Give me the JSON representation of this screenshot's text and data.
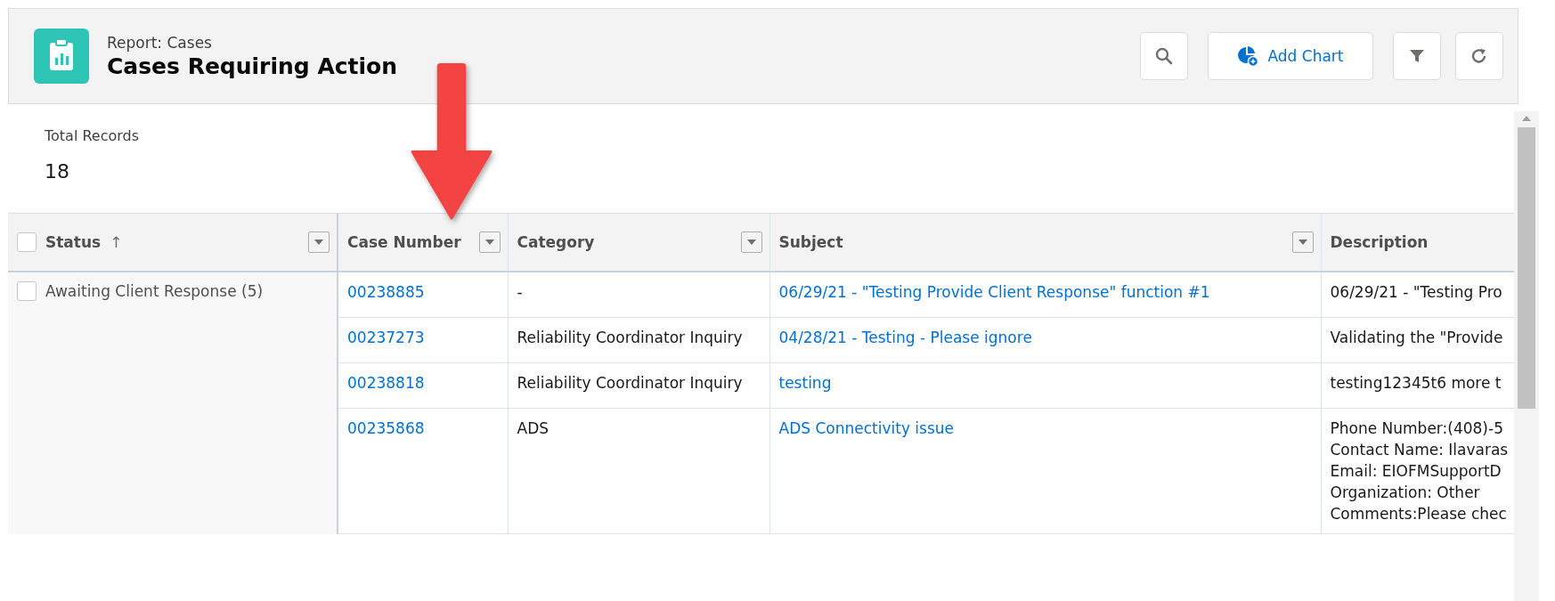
{
  "header": {
    "subtitle": "Report: Cases",
    "title": "Cases Requiring Action",
    "buttons": [
      {
        "kind": "search"
      },
      {
        "kind": "add-chart",
        "label": "Add Chart"
      },
      {
        "kind": "filter"
      },
      {
        "kind": "refresh"
      }
    ]
  },
  "summary": {
    "label": "Total Records",
    "value": "18"
  },
  "table": {
    "columns": [
      {
        "label": "Status",
        "sort_mark": "↑",
        "menu": true,
        "checked": false
      },
      {
        "label": "Case Number",
        "menu": true
      },
      {
        "label": "Category",
        "menu": true
      },
      {
        "label": "Subject",
        "menu": true
      },
      {
        "label": "Description",
        "menu": false
      }
    ],
    "groups": [
      {
        "label": "Awaiting Client Response (5)",
        "checked": false,
        "rows": [
          {
            "case_number": "00238885",
            "category": "-",
            "subject": "06/29/21 - \"Testing Provide Client Response\" function #1",
            "description": [
              "06/29/21 - \"Testing Pro"
            ]
          },
          {
            "case_number": "00237273",
            "category": "Reliability Coordinator Inquiry",
            "subject": "04/28/21 - Testing - Please ignore",
            "description": [
              "Validating the \"Provide"
            ]
          },
          {
            "case_number": "00238818",
            "category": "Reliability Coordinator Inquiry",
            "subject": "testing",
            "description": [
              "testing12345t6 more t"
            ]
          },
          {
            "case_number": "00235868",
            "category": "ADS",
            "subject": "ADS Connectivity issue",
            "description": [
              "Phone Number:(408)-5",
              "Contact Name: Ilavaras",
              "Email: EIOFMSupportD",
              "Organization: Other",
              "Comments:Please chec"
            ]
          }
        ]
      }
    ]
  },
  "annotation": {
    "kind": "arrow"
  }
}
